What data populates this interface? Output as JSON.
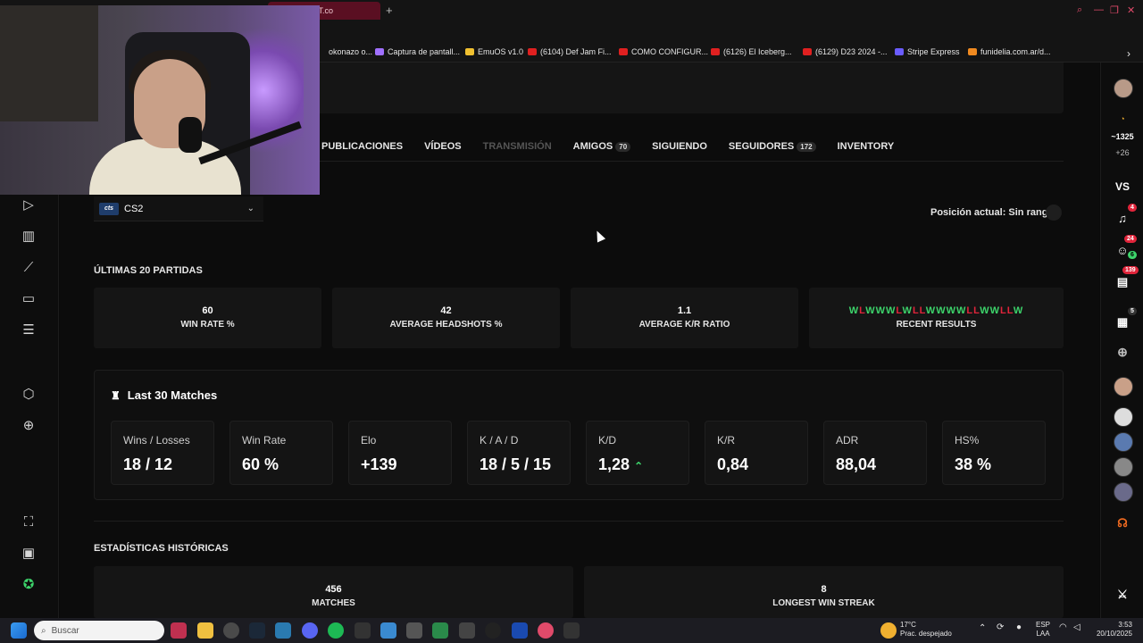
{
  "browser": {
    "tab_title": "tats - FACEIT.co",
    "bookmarks": [
      "okonazo o...",
      "Captura de pantall...",
      "EmuOS v1.0",
      "(6104) Def Jam Fi...",
      "COMO CONFIGUR...",
      "(6126) El Iceberg...",
      "(6129) D23 2024 -...",
      "Stripe Express",
      "funidelia.com.ar/d..."
    ],
    "bookmark_colors": [
      "#888888",
      "#a070ff",
      "#f0c030",
      "#e02020",
      "#e02020",
      "#e02020",
      "#e02020",
      "#6a5cff",
      "#f08a20"
    ]
  },
  "profile_nav": {
    "items": [
      {
        "label": "PUBLICACIONES",
        "count": "",
        "disabled": false
      },
      {
        "label": "VÍDEOS",
        "count": "",
        "disabled": false
      },
      {
        "label": "TRANSMISIÓN",
        "count": "",
        "disabled": true
      },
      {
        "label": "AMIGOS",
        "count": "70",
        "disabled": false
      },
      {
        "label": "SIGUIENDO",
        "count": "",
        "disabled": false
      },
      {
        "label": "SEGUIDORES",
        "count": "172",
        "disabled": false
      },
      {
        "label": "INVENTORY",
        "count": "",
        "disabled": false
      }
    ]
  },
  "game_select": {
    "logo": "cts",
    "value": "CS2"
  },
  "rank": {
    "label": "Posición actual: Sin rango"
  },
  "last20": {
    "title": "ÚLTIMAS 20 PARTIDAS",
    "cards": [
      {
        "value": "60",
        "label": "WIN RATE %"
      },
      {
        "value": "42",
        "label": "AVERAGE HEADSHOTS %"
      },
      {
        "value": "1.1",
        "label": "AVERAGE K/R RATIO"
      }
    ],
    "recent_results_label": "RECENT RESULTS",
    "recent_results": [
      "W",
      "L",
      "W",
      "W",
      "W",
      "L",
      "W",
      "L",
      "L",
      "W",
      "W",
      "W",
      "W",
      "L",
      "L",
      "W",
      "W",
      "L",
      "L",
      "W"
    ]
  },
  "last30": {
    "title": "Last 30 Matches",
    "cards": [
      {
        "label": "Wins / Losses",
        "value": "18 / 12"
      },
      {
        "label": "Win Rate",
        "value": "60 %"
      },
      {
        "label": "Elo",
        "value": "+139"
      },
      {
        "label": "K / A / D",
        "value": "18 / 5 / 15"
      },
      {
        "label": "K/D",
        "value": "1,28"
      },
      {
        "label": "K/R",
        "value": "0,84"
      },
      {
        "label": "ADR",
        "value": "88,04"
      },
      {
        "label": "HS%",
        "value": "38 %"
      }
    ]
  },
  "historical": {
    "title": "ESTADÍSTICAS HISTÓRICAS",
    "cards": [
      {
        "value": "456",
        "label": "MATCHES"
      },
      {
        "value": "8",
        "label": "LONGEST WIN STREAK"
      }
    ]
  },
  "right_sidebar": {
    "elo": "~1325",
    "elo_change": "+26",
    "vs": "VS",
    "notif_badge": "4",
    "friends_badge": "24",
    "friends_online": "6",
    "chat_badge": "139",
    "party_badge": "5"
  },
  "taskbar": {
    "search_placeholder": "Buscar",
    "weather_temp": "17°C",
    "weather_desc": "Prac. despejado",
    "lang": "ESP",
    "lang2": "LAA",
    "time": "3:53",
    "date": "20/10/2025"
  }
}
